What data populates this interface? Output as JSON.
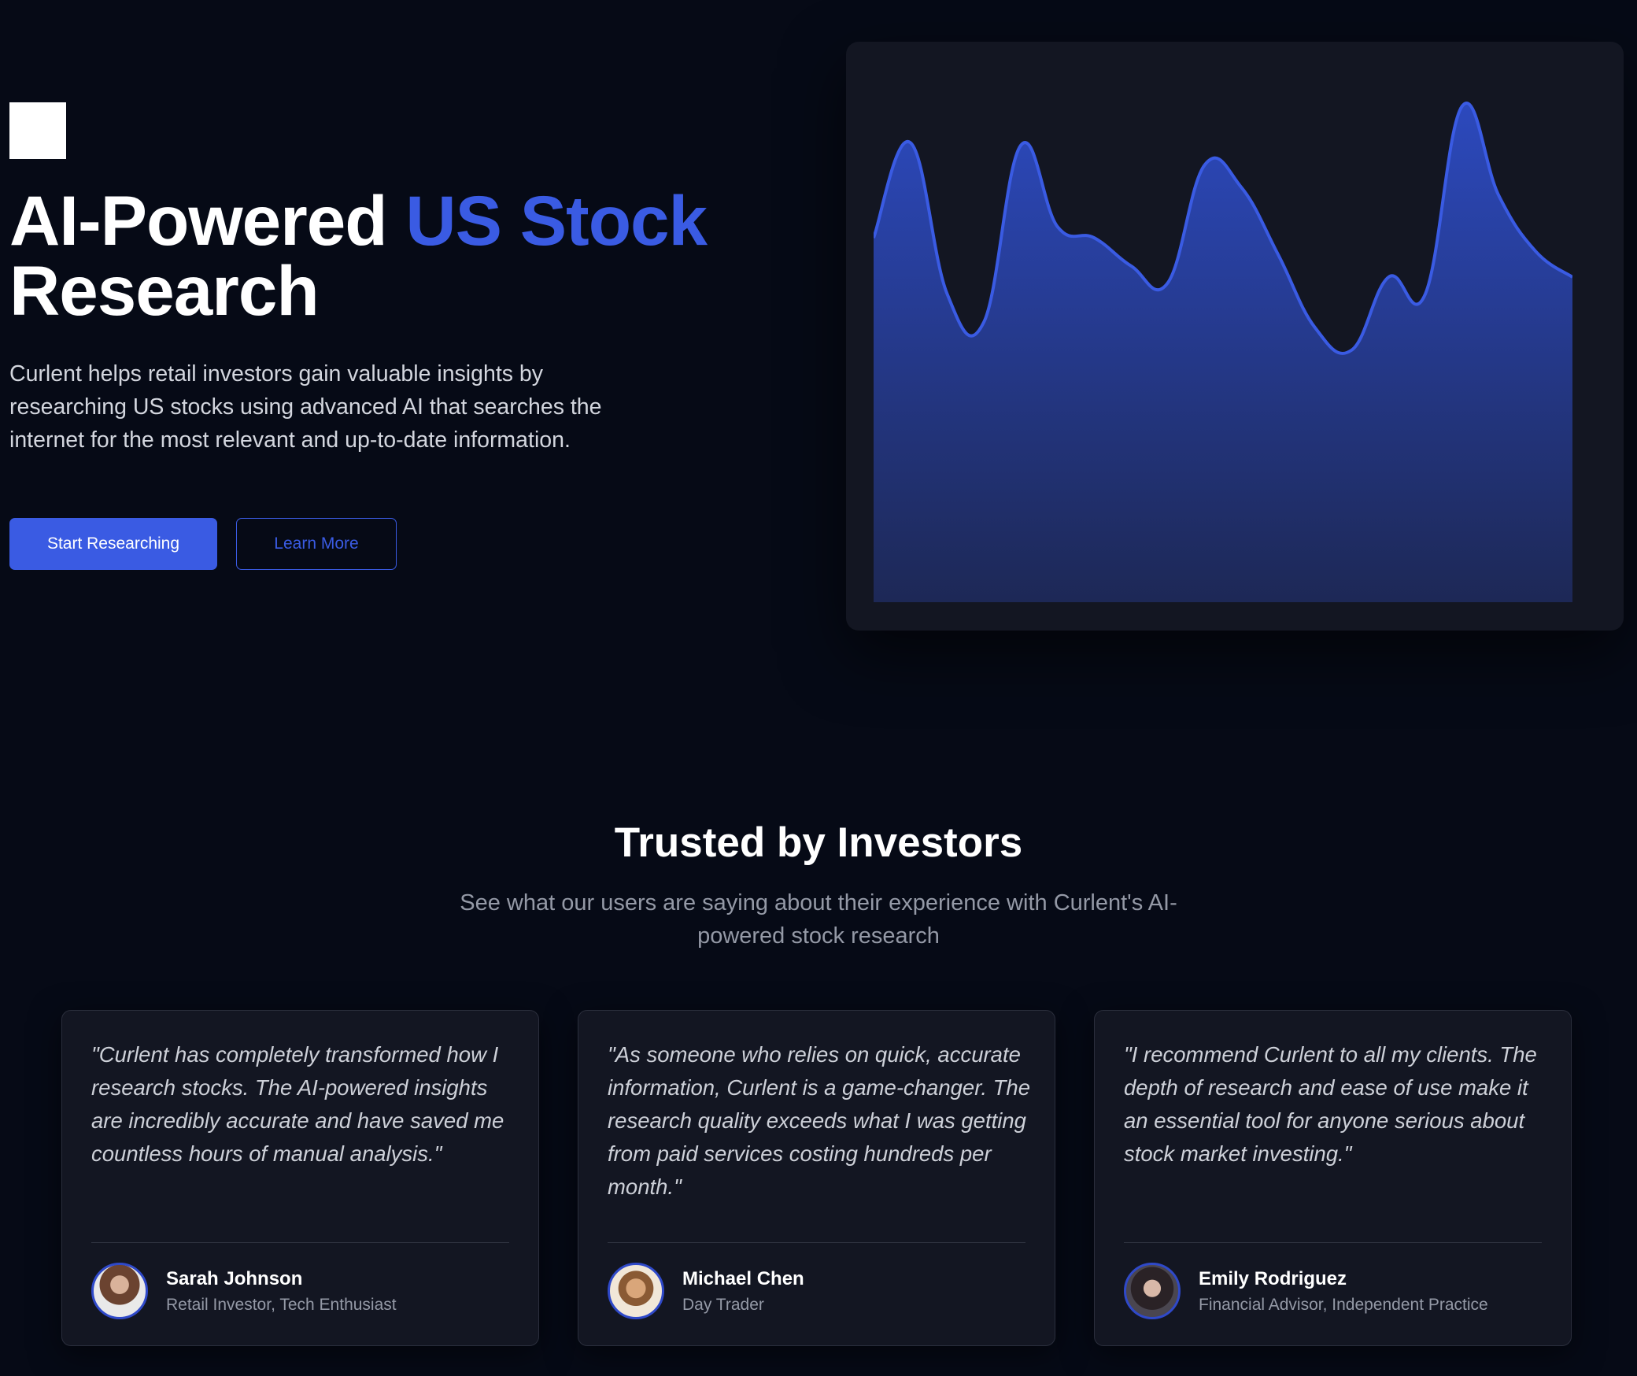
{
  "hero": {
    "title_part1": "AI-Powered ",
    "title_accent": "US Stock",
    "title_part2": "Research",
    "description": "Curlent helps retail investors gain valuable insights by researching US stocks using advanced AI that searches the internet for the most relevant and up-to-date information.",
    "primary_button": "Start Researching",
    "secondary_button": "Learn More",
    "accent_color": "#3a5be3"
  },
  "chart_data": {
    "type": "area",
    "x": [
      0,
      1,
      2,
      3,
      4,
      5,
      6,
      7,
      8,
      9,
      10,
      11,
      12,
      13,
      14,
      15,
      16,
      17,
      18,
      19
    ],
    "values": [
      65,
      82,
      55,
      50,
      81.5,
      67,
      65,
      60,
      57,
      78,
      74,
      62,
      49,
      45,
      58,
      55,
      88.5,
      72.5,
      62.6,
      58
    ],
    "ylim": [
      0,
      100
    ],
    "grid": false,
    "line_color": "#3a5be3",
    "fill_color": "#2a45b0"
  },
  "testimonials": {
    "title": "Trusted by Investors",
    "subtitle": "See what our users are saying about their experience with Curlent's AI-powered stock research",
    "items": [
      {
        "quote": "\"Curlent has completely transformed how I research stocks. The AI-powered insights are incredibly accurate and have saved me countless hours of manual analysis.\"",
        "name": "Sarah Johnson",
        "role": "Retail Investor, Tech Enthusiast"
      },
      {
        "quote": "\"As someone who relies on quick, accurate information, Curlent is a game-changer. The research quality exceeds what I was getting from paid services costing hundreds per month.\"",
        "name": "Michael Chen",
        "role": "Day Trader"
      },
      {
        "quote": "\"I recommend Curlent to all my clients. The depth of research and ease of use make it an essential tool for anyone serious about stock market investing.\"",
        "name": "Emily Rodriguez",
        "role": "Financial Advisor, Independent Practice"
      }
    ]
  }
}
